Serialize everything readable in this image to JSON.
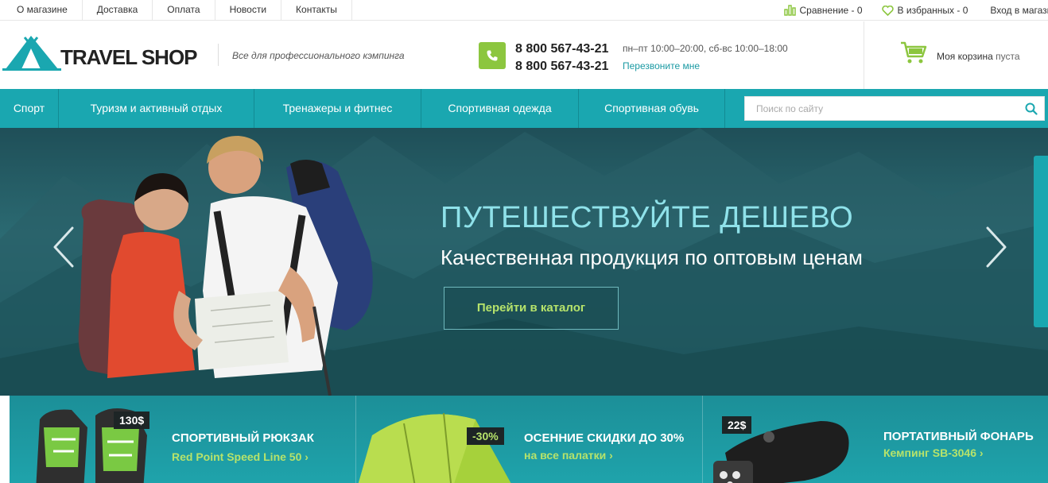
{
  "topnav": {
    "items": [
      "О магазине",
      "Доставка",
      "Оплата",
      "Новости",
      "Контакты"
    ]
  },
  "topright": {
    "compare": "Сравнение - 0",
    "favorites": "В избранных - 0",
    "login": "Вход в магазин"
  },
  "header": {
    "logo_text": "TRAVEL SHOP",
    "tagline": "Все для профессионального кэмпинга",
    "phone1": "8 800 567-43-21",
    "phone2": "8 800 567-43-21",
    "hours": "пн–пт 10:00–20:00, сб-вс 10:00–18:00",
    "callback": "Перезвоните мне",
    "cart_label": "Моя корзина",
    "cart_status": "пуста"
  },
  "nav": {
    "items": [
      "Спорт",
      "Туризм и активный отдых",
      "Тренажеры и фитнес",
      "Спортивная одежда",
      "Спортивная обувь"
    ],
    "search_placeholder": "Поиск по сайту"
  },
  "hero": {
    "title": "ПУТЕШЕСТВУЙТЕ ДЕШЕВО",
    "subtitle": "Качественная продукция по оптовым ценам",
    "button": "Перейти в каталог"
  },
  "promos": [
    {
      "tag": "130$",
      "title": "СПОРТИВНЫЙ РЮКЗАК",
      "link": "Red Point Speed Line 50 ›"
    },
    {
      "tag": "-30%",
      "title": "ОСЕННИЕ СКИДКИ ДО 30%",
      "link": "на все палатки ›"
    },
    {
      "tag": "22$",
      "title": "ПОРТАТИВНЫЙ ФОНАРЬ",
      "link": "Кемпинг SB-3046 ›"
    }
  ],
  "colors": {
    "accent": "#1aa7b0",
    "green": "#8cc63f",
    "hero_title": "#8fe2ea",
    "link_green": "#b6e36b"
  }
}
